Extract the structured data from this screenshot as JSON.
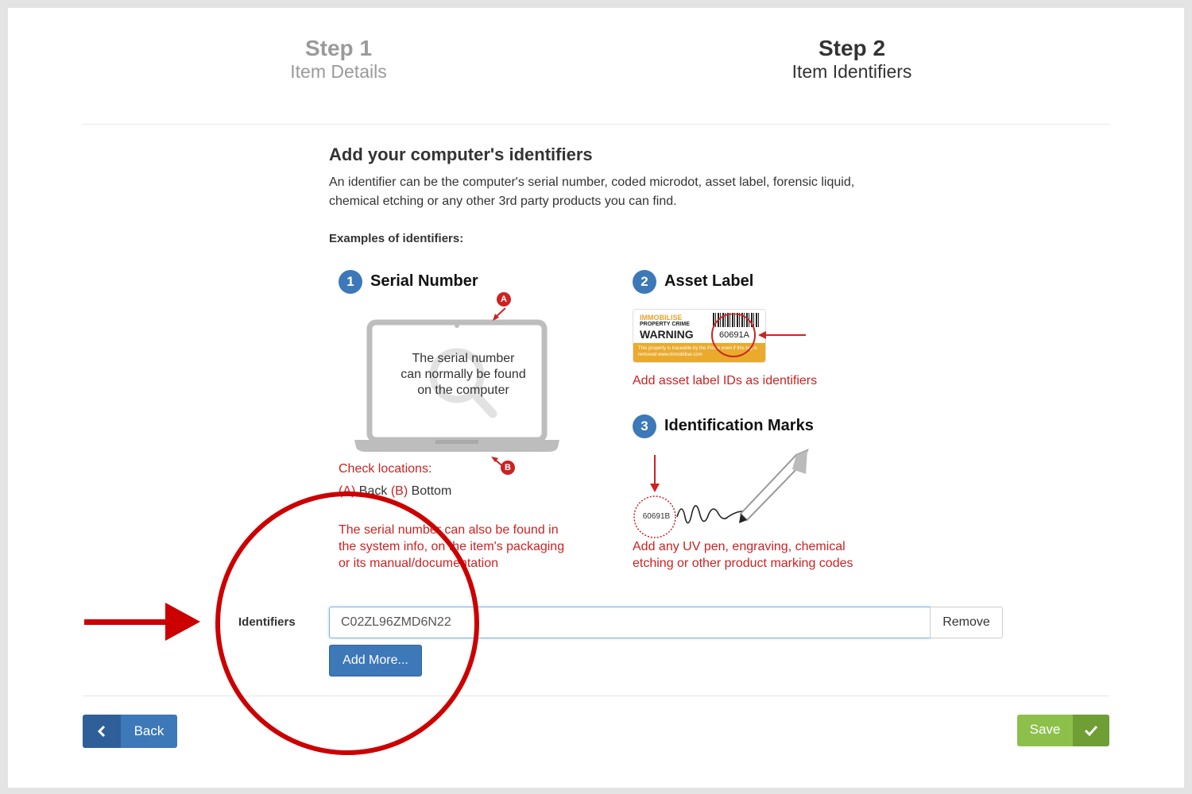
{
  "steps": [
    {
      "number": "Step 1",
      "label": "Item Details"
    },
    {
      "number": "Step 2",
      "label": "Item Identifiers"
    }
  ],
  "heading": "Add your computer's identifiers",
  "intro": {
    "line1": "An identifier can be the computer's serial number, coded microdot, asset label, forensic liquid,",
    "line2": "chemical etching or any other 3rd party products you can find."
  },
  "examples_title": "Examples of identifiers:",
  "examples": {
    "serial": {
      "badge": "1",
      "title": "Serial Number",
      "laptop_text": [
        "The serial number",
        "can normally be found",
        "on the computer"
      ],
      "marker_a": "A",
      "marker_b": "B",
      "check_locations": "Check locations:",
      "loc_a": "(A)",
      "loc_a_text": "Back",
      "loc_b": "(B)",
      "loc_b_text": "Bottom",
      "note": [
        "The serial number can also be found in",
        "the system info, on the item's packaging",
        "or its manual/documentation"
      ]
    },
    "asset": {
      "badge": "2",
      "title": "Asset Label",
      "label_brand": "IMMOBILISE",
      "label_sub": "PROPERTY CRIME",
      "label_warning": "WARNING",
      "label_code": "60691A",
      "label_footer": "This property is traceable by the Police even if this tag is removed  www.immobilise.com",
      "caption": "Add asset label IDs as identifiers"
    },
    "marks": {
      "badge": "3",
      "title": "Identification Marks",
      "code": "60691B",
      "caption": [
        "Add any UV pen, engraving, chemical",
        "etching or other product marking codes"
      ]
    }
  },
  "identifiers": {
    "label": "Identifiers",
    "value": "C02ZL96ZMD6N22",
    "remove_label": "Remove",
    "add_more_label": "Add More..."
  },
  "footer": {
    "back_label": "Back",
    "save_label": "Save"
  },
  "colors": {
    "accent_blue": "#3d78b8",
    "annotation_red": "#cc0000",
    "save_green": "#8dc04a"
  }
}
